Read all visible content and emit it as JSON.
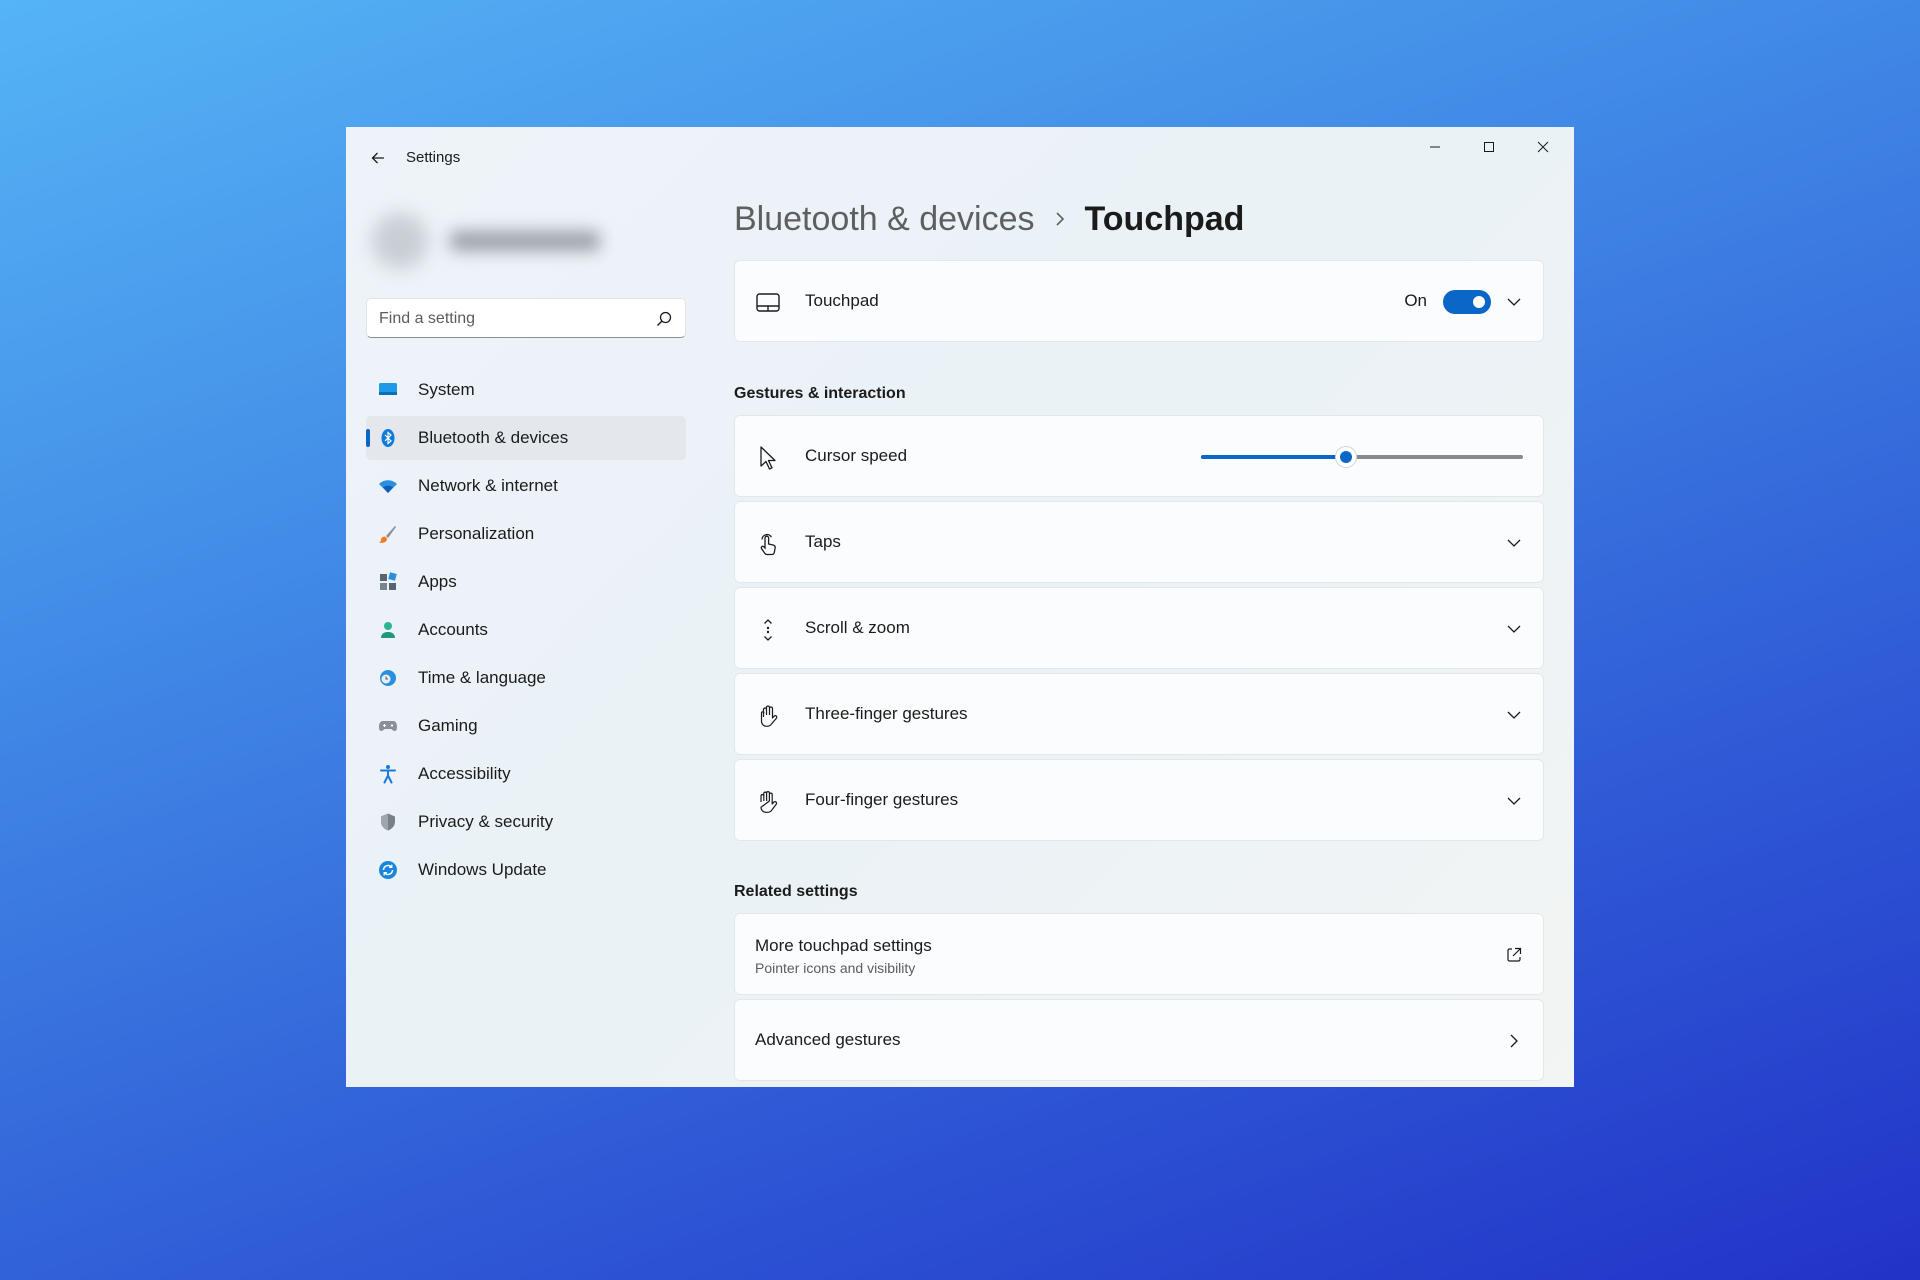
{
  "window": {
    "title": "Settings"
  },
  "search": {
    "placeholder": "Find a setting"
  },
  "sidebar": {
    "items": [
      {
        "label": "System",
        "icon": "monitor-icon"
      },
      {
        "label": "Bluetooth & devices",
        "icon": "bluetooth-icon",
        "selected": true
      },
      {
        "label": "Network & internet",
        "icon": "wifi-icon"
      },
      {
        "label": "Personalization",
        "icon": "brush-icon"
      },
      {
        "label": "Apps",
        "icon": "apps-icon"
      },
      {
        "label": "Accounts",
        "icon": "person-icon"
      },
      {
        "label": "Time & language",
        "icon": "globe-clock-icon"
      },
      {
        "label": "Gaming",
        "icon": "gamepad-icon"
      },
      {
        "label": "Accessibility",
        "icon": "accessibility-icon"
      },
      {
        "label": "Privacy & security",
        "icon": "shield-icon"
      },
      {
        "label": "Windows Update",
        "icon": "update-icon"
      }
    ]
  },
  "breadcrumb": {
    "parent": "Bluetooth & devices",
    "current": "Touchpad"
  },
  "touchpad_card": {
    "label": "Touchpad",
    "state": "On",
    "enabled": true,
    "icon": "touchpad-icon"
  },
  "gestures": {
    "section_title": "Gestures & interaction",
    "cursor_speed": {
      "label": "Cursor speed",
      "value": 0.45,
      "icon": "cursor-icon"
    },
    "items": [
      {
        "label": "Taps",
        "icon": "tap-icon"
      },
      {
        "label": "Scroll & zoom",
        "icon": "scroll-icon"
      },
      {
        "label": "Three-finger gestures",
        "icon": "hand-icon"
      },
      {
        "label": "Four-finger gestures",
        "icon": "hand-icon"
      }
    ]
  },
  "related": {
    "section_title": "Related settings",
    "more": {
      "title": "More touchpad settings",
      "subtitle": "Pointer icons and visibility"
    },
    "advanced": {
      "title": "Advanced gestures"
    }
  },
  "colors": {
    "accent": "#0a67c8",
    "background_top": "#55b4f5",
    "background_bottom": "#2233c8"
  }
}
